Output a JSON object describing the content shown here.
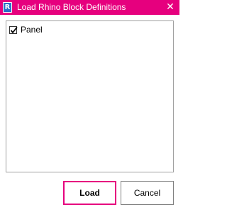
{
  "window": {
    "title": "Load Rhino Block Definitions",
    "app_icon_letter": "R",
    "close_glyph": "✕",
    "accent_color": "#e6007e"
  },
  "list": {
    "items": [
      {
        "label": "Panel",
        "checked": true
      }
    ]
  },
  "buttons": {
    "load_label": "Load",
    "cancel_label": "Cancel"
  }
}
